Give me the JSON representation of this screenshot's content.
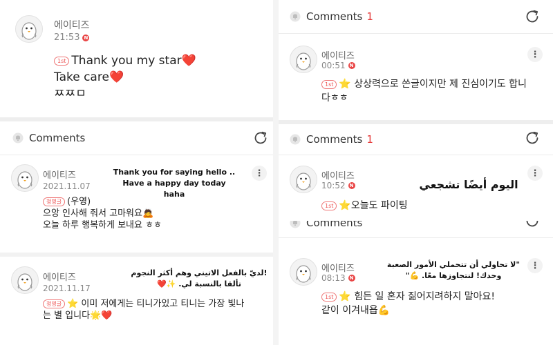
{
  "top_post": {
    "author": "에이티즈",
    "time": "21:53",
    "badge": "N",
    "rank": "1st",
    "line1": "Thank you my star",
    "line1_emoji": "❤️",
    "line2": "Take care",
    "line2_emoji": "❤️",
    "line3": "ㅉㅉㅁ"
  },
  "left_comments": {
    "label": "Comments",
    "comment1": {
      "author": "에이티즈",
      "date": "2021.11.07",
      "rank": "청명글",
      "line1": "(우영)",
      "line2": "으앙 인사해 줘서 고마워요",
      "line2_emoji": "🙇",
      "line3": "오늘 하루 행복하게 보내요 ㅎㅎ",
      "translation": "Thank you for saying hello .. Have a happy day today haha",
      "more": "⋮"
    },
    "comment2": {
      "author": "에이티즈",
      "date": "2021.11.17",
      "rank": "청명글",
      "star": "⭐",
      "line1": "이미 저에게는 티니가있고 티니는 가장 빛나",
      "line2": "는 별 입니다",
      "line2_emoji": "🌟❤️",
      "translation": "!لديّ بالفعل الاتيني وهم أكثر النجوم تألقا بالنسبة لي. ✨❤️",
      "more": "⋮"
    }
  },
  "right_top": {
    "label": "Comments",
    "count": "1",
    "comment": {
      "author": "에이티즈",
      "time": "00:51",
      "badge": "N",
      "rank": "1st",
      "star": "⭐",
      "line1": "상상력으로 쓴글이지만 제 진심이기도 합니",
      "line2": "다ㅎㅎ",
      "more": "⋮"
    }
  },
  "right_mid": {
    "label": "Comments",
    "count": "1",
    "comment": {
      "author": "에이티즈",
      "time": "10:52",
      "badge": "N",
      "rank": "1st",
      "star": "⭐",
      "line1": "오늘도 파이팅",
      "translation": "اليوم أيضًا تشجعي",
      "more": "⋮"
    }
  },
  "right_bottom": {
    "label": "Comments",
    "comment": {
      "author": "에이티즈",
      "time": "08:13",
      "badge": "N",
      "rank": "1st",
      "star": "⭐",
      "line1": "힘든 일 혼자 짊어지려하지 말아요!",
      "line2": "같이 이겨내욥",
      "line2_emoji": "💪",
      "translation": "\"لا تحاولي أن تتحملي الأمور الصعبة وحدك! لنتجاوزها معًا. 💪\"",
      "more": "⋮"
    }
  },
  "colors": {
    "accent_red": "#e53a3a",
    "star": "#f5b400",
    "divider": "#ececec"
  }
}
